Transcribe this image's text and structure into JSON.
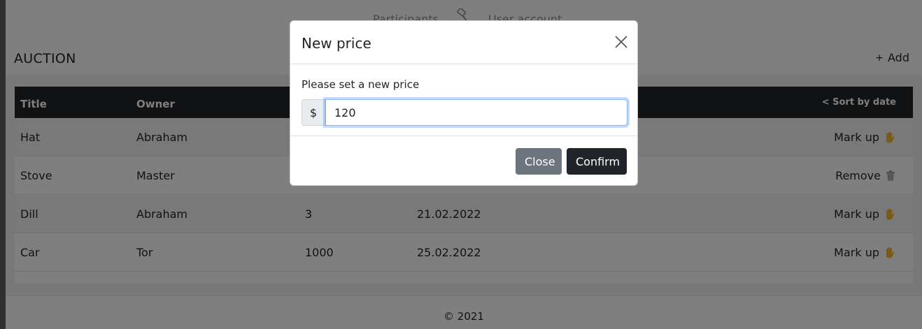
{
  "nav": {
    "participants": "Participants",
    "user_account": "User account"
  },
  "page": {
    "title": "AUCTION",
    "add_label": "Add"
  },
  "table": {
    "headers": {
      "title": "Title",
      "owner": "Owner",
      "sort": "< Sort by date"
    },
    "rows": [
      {
        "title": "Hat",
        "owner": "Abraham",
        "price": "",
        "date": "",
        "action": "Mark up",
        "action_icon": "hand-icon"
      },
      {
        "title": "Stove",
        "owner": "Master",
        "price": "",
        "date": "",
        "action": "Remove",
        "action_icon": "trash-icon"
      },
      {
        "title": "Dill",
        "owner": "Abraham",
        "price": "3",
        "date": "21.02.2022",
        "action": "Mark up",
        "action_icon": "hand-icon"
      },
      {
        "title": "Car",
        "owner": "Tor",
        "price": "1000",
        "date": "25.02.2022",
        "action": "Mark up",
        "action_icon": "hand-icon"
      }
    ]
  },
  "footer": {
    "copyright": "© 2021"
  },
  "modal": {
    "title": "New price",
    "label": "Please set a new price",
    "currency": "$",
    "price_value": "120",
    "close_label": "Close",
    "confirm_label": "Confirm"
  },
  "colors": {
    "dark": "#212529",
    "secondary": "#6c757d",
    "focus": "#86b7fe",
    "hand": "#f5b52e"
  }
}
